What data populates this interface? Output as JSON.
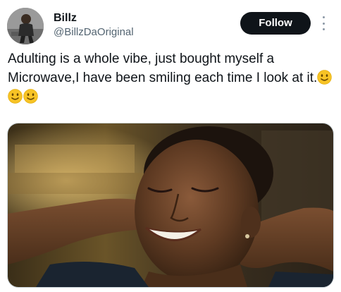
{
  "author": {
    "display_name": "Billz",
    "handle": "@BillzDaOriginal"
  },
  "follow_label": "Follow",
  "tweet": {
    "text": "Adulting is a whole vibe, just bought myself a Microwave,I have been smiling each time I look at it.",
    "emojis": [
      "slightly-smiling-face",
      "slightly-smiling-face",
      "slightly-smiling-face"
    ]
  },
  "colors": {
    "follow_bg": "#0f1419",
    "follow_text": "#ffffff",
    "handle": "#536471",
    "emoji_face": "#f7c325"
  },
  "media": {
    "kind": "photo",
    "subject": "smiling woman with eyes closed, hands behind head"
  }
}
